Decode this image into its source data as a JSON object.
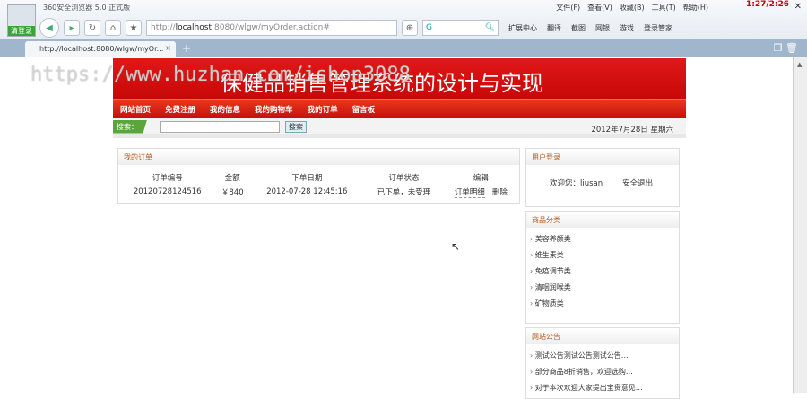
{
  "browser": {
    "app_title": "360安全浏览器 5.0 正式版",
    "login_label": "清登录",
    "menu": [
      "文件(F)",
      "查看(V)",
      "收藏(B)",
      "工具(T)",
      "帮助(H)"
    ],
    "clock": "1:27/2:26",
    "url_prefix": "http://",
    "url_host": "localhost",
    "url_rest": ":8080/wlgw/myOrder.action#",
    "extensions": [
      "扩展中心",
      "翻译",
      "截图",
      "网银",
      "游戏",
      "登录管家"
    ],
    "tab_title": "http://localhost:8080/wlgw/myOr..."
  },
  "site": {
    "title": "保健品销售管理系统的设计与实现",
    "watermark": "https://www.huzhan.com/ishop3088",
    "nav": [
      "网站首页",
      "免费注册",
      "我的信息",
      "我的购物车",
      "我的订单",
      "留言板"
    ],
    "search_label": "搜索：",
    "search_value": "",
    "search_button": "搜索",
    "date": "2012年7月28日 星期六"
  },
  "orders": {
    "title": "我的订单",
    "headers": [
      "订单编号",
      "金额",
      "下单日期",
      "订单状态",
      "编辑"
    ],
    "rows": [
      {
        "id": "20120728124516",
        "amount": "￥840",
        "date": "2012-07-28 12:45:16",
        "status": "已下单，未受理",
        "detail": "订单明细",
        "delete": "删除"
      }
    ]
  },
  "login": {
    "title": "用户登录",
    "welcome": "欢迎您：liusan",
    "logout": "安全退出"
  },
  "categories": {
    "title": "商品分类",
    "items": [
      "美容养颜类",
      "维生素类",
      "免疫调节类",
      "清咽润喉类",
      "矿物质类"
    ]
  },
  "notices": {
    "title": "网站公告",
    "items": [
      "测试公告测试公告测试公告…",
      "部分商品8折销售，欢迎选购…",
      "对于本次欢迎大家提出宝贵意见…"
    ]
  }
}
